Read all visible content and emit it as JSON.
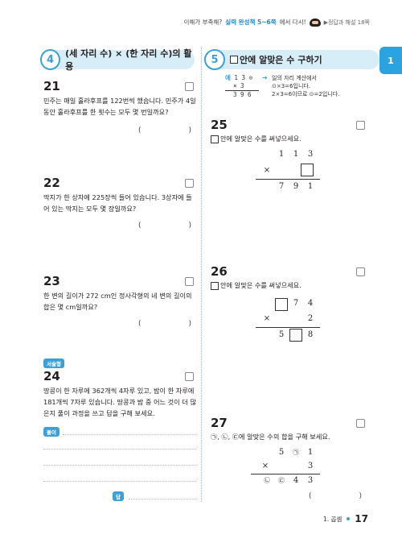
{
  "top_note": {
    "prefix": "이해가 부족해?",
    "highlight": "실력 완성책 5~6쪽",
    "suffix": "에서 다시!",
    "answer_ref": "▶정답과 해설 18쪽"
  },
  "side_tab": {
    "label": "1"
  },
  "left_section": {
    "number": "4",
    "title": "(세 자리 수) × (한 자리 수)의 활용"
  },
  "right_section": {
    "number": "5",
    "title": "안에 알맞은 수 구하기"
  },
  "example": {
    "label": "예",
    "row1": "1 3 ⊙",
    "row2": "×     3",
    "row3": "3 9 6",
    "text1": "일의 자리 계산에서",
    "text2": "⊙×3=6입니다.",
    "text3": "2×3=6이므로 ⊙=2입니다."
  },
  "problems": {
    "p21": {
      "num": "21",
      "text": "민주는 매일 훌라후프를 122번씩 했습니다. 민주가 4일 동안 훌라후프를 한 횟수는 모두 몇 번일까요?"
    },
    "p22": {
      "num": "22",
      "text": "딱지가 한 상자에 225장씩 들어 있습니다. 3상자에 들어 있는 딱지는 모두 몇 장일까요?"
    },
    "p23": {
      "num": "23",
      "text": "한 변의 길이가 272 cm인 정사각형의 네 변의 길이의 합은 몇 cm일까요?"
    },
    "p24": {
      "num": "24",
      "badge": "서술형",
      "text": "땅콩이 한 자루에 362개씩 4자루 있고, 밤이 한 자루에 181개씩 7자루 있습니다. 땅콩과 밤 중 어느 것이 더 많은지 풀이 과정을 쓰고 답을 구해 보세요.",
      "work_label": "풀이",
      "answer_label": "답"
    },
    "p25": {
      "num": "25",
      "text": "안에 알맞은 수를 써넣으세요.",
      "r1": [
        "1",
        "1",
        "3"
      ],
      "op": "×",
      "r3": [
        "7",
        "9",
        "1"
      ]
    },
    "p26": {
      "num": "26",
      "text": "안에 알맞은 수를 써넣으세요.",
      "r1": [
        "7",
        "4"
      ],
      "op": "×",
      "r2": "2",
      "r3": [
        "5",
        "8"
      ]
    },
    "p27": {
      "num": "27",
      "text": "㉠, ㉡, ㉢에 알맞은 수의 합을 구해 보세요.",
      "r1": [
        "5",
        "㉠",
        "1"
      ],
      "op": "×",
      "r2": "3",
      "r3": [
        "㉡",
        "㉢",
        "4",
        "3"
      ]
    }
  },
  "paren": {
    "open": "(",
    "close": ")"
  },
  "footer": {
    "chapter": "1. 곱셈",
    "page": "17"
  }
}
